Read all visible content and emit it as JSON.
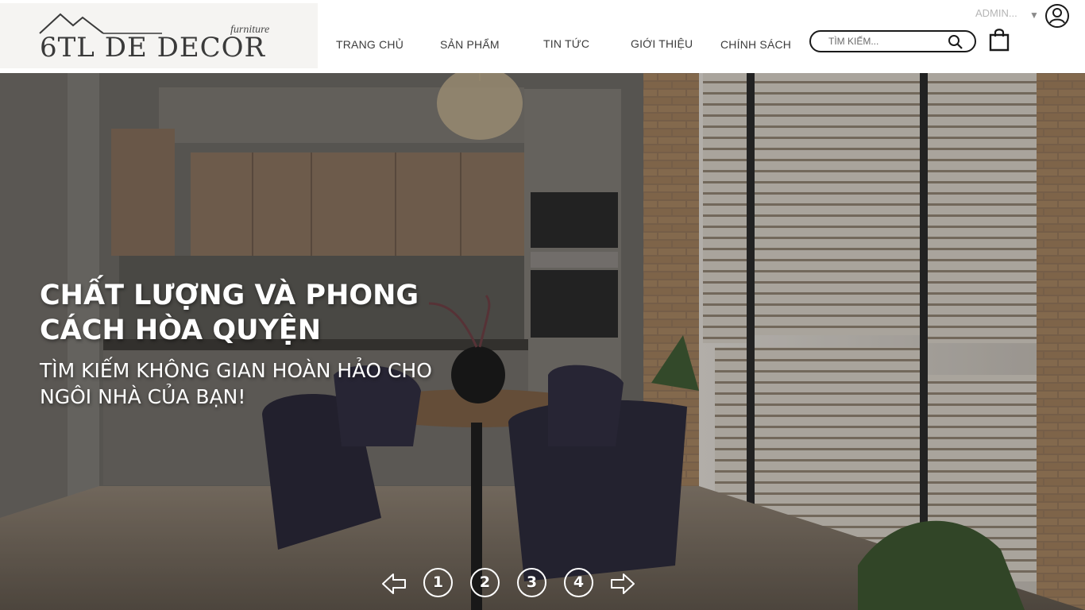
{
  "brand": {
    "name": "6TL DE DECOR",
    "tagline": "furniture"
  },
  "nav": {
    "items": [
      {
        "label": "TRANG CHỦ"
      },
      {
        "label": "SẢN PHẨM"
      },
      {
        "label": "TIN TỨC"
      },
      {
        "label": "GIỚI THIỆU"
      },
      {
        "label": "CHÍNH SÁCH"
      }
    ]
  },
  "account": {
    "label": "ADMIN...",
    "caret": "▼",
    "icon": "user-circle-icon"
  },
  "search": {
    "placeholder": "TÌM KIẾM...",
    "icon": "search-icon"
  },
  "cart": {
    "icon": "shopping-bag-icon"
  },
  "hero": {
    "title": "CHẤT LƯỢNG VÀ PHONG CÁCH HÒA QUYỆN",
    "subtitle": "TÌM KIẾM KHÔNG GIAN HOÀN HẢO CHO NGÔI NHÀ CỦA BẠN!",
    "pages": [
      "1",
      "2",
      "3",
      "4"
    ],
    "prev_icon": "arrow-left-icon",
    "next_icon": "arrow-right-icon"
  },
  "colors": {
    "text_dark": "#3c3c3c",
    "muted": "#b5b5b5",
    "white": "#ffffff"
  }
}
